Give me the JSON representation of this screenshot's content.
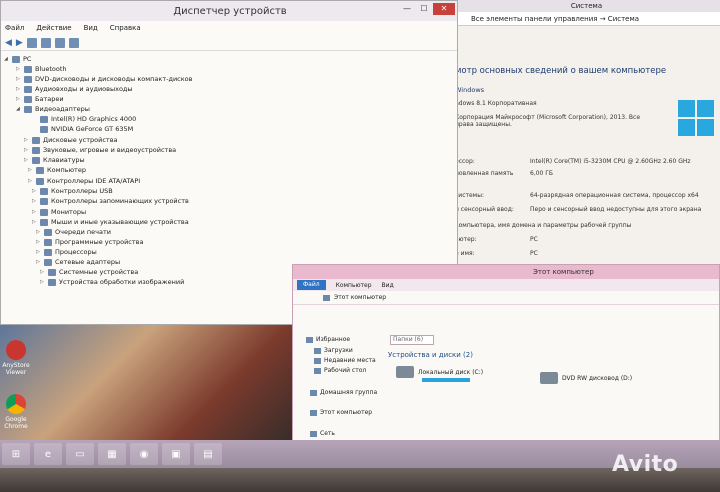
{
  "system_window": {
    "title": "Система",
    "address": "Все элементы панели управления  →  Система",
    "heading": "мотр основных сведений о вашем компьютере",
    "edition_header": "Windows",
    "edition": "ndows 8.1 Корпоративная",
    "copyright": "Корпорация Майкрософт (Microsoft Corporation), 2013. Все права защищены.",
    "rows": [
      {
        "label": "ессор:",
        "value": "Intel(R) Core(TM) i5-3230M CPU @ 2.60GHz   2.60 GHz"
      },
      {
        "label": "новленная память",
        "value": "6,00 ГБ"
      },
      {
        "label": "системы:",
        "value": "64-разрядная операционная система, процессор x64"
      },
      {
        "label": "и сенсорный ввод:",
        "value": "Перо и сенсорный ввод недоступны для этого экрана"
      },
      {
        "label": "компьютера, имя домена и параметры рабочей группы",
        "value": ""
      },
      {
        "label": "ьютер:",
        "value": "PC"
      },
      {
        "label": "е имя:",
        "value": "PC"
      }
    ]
  },
  "device_manager": {
    "title": "Диспетчер устройств",
    "menu": [
      "Файл",
      "Действие",
      "Вид",
      "Справка"
    ],
    "tree": [
      {
        "label": "PC",
        "level": 0,
        "expanded": true
      },
      {
        "label": "Bluetooth",
        "level": 1
      },
      {
        "label": "DVD-дисководы и дисководы компакт-дисков",
        "level": 1
      },
      {
        "label": "Аудиовходы и аудиовыходы",
        "level": 1
      },
      {
        "label": "Батареи",
        "level": 1
      },
      {
        "label": "Видеоадаптеры",
        "level": 1,
        "expanded": true
      },
      {
        "label": "Intel(R) HD Graphics 4000",
        "level": 2
      },
      {
        "label": "NVIDIA GeForce GT 635M",
        "level": 2
      },
      {
        "label": "Дисковые устройства",
        "level": 1
      },
      {
        "label": "Звуковые, игровые и видеоустройства",
        "level": 1
      },
      {
        "label": "Клавиатуры",
        "level": 1
      },
      {
        "label": "Компьютер",
        "level": 1
      },
      {
        "label": "Контроллеры IDE ATA/ATAPI",
        "level": 1
      },
      {
        "label": "Контроллеры USB",
        "level": 1
      },
      {
        "label": "Контроллеры запоминающих устройств",
        "level": 1
      },
      {
        "label": "Мониторы",
        "level": 1
      },
      {
        "label": "Мыши и иные указывающие устройства",
        "level": 1
      },
      {
        "label": "Очереди печати",
        "level": 1
      },
      {
        "label": "Программные устройства",
        "level": 1
      },
      {
        "label": "Процессоры",
        "level": 1
      },
      {
        "label": "Сетевые адаптеры",
        "level": 1
      },
      {
        "label": "Системные устройства",
        "level": 1
      },
      {
        "label": "Устройства обработки изображений",
        "level": 1
      }
    ]
  },
  "explorer": {
    "title": "Этот компьютер",
    "tabs": [
      "Файл",
      "Компьютер",
      "Вид"
    ],
    "address": "Этот компьютер",
    "nav": [
      "Избранное",
      "Загрузки",
      "Недавние места",
      "Рабочий стол",
      "Домашняя группа",
      "Этот компьютер",
      "Сеть"
    ],
    "folders_label": "Папки (6)",
    "group_label": "Устройства и диски (2)",
    "drives": [
      "Локальный диск (C:)",
      "DVD RW дисковод (D:)"
    ]
  },
  "desktop": {
    "icons": [
      "AnyStore Viewer",
      "Google Chrome"
    ]
  },
  "watermark": "Avito"
}
